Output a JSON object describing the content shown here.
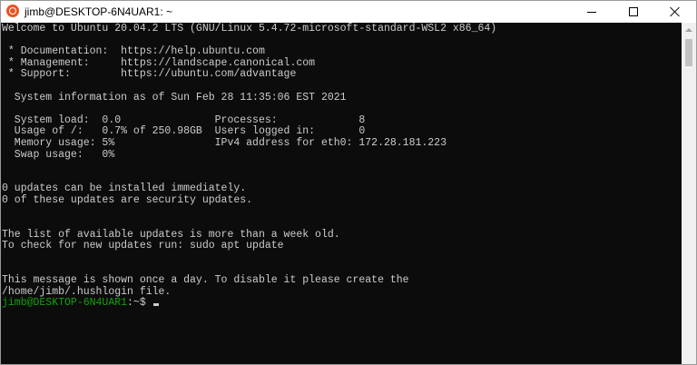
{
  "window": {
    "title": "jimb@DESKTOP-6N4UAR1: ~",
    "app_icon": "ubuntu-icon"
  },
  "terminal": {
    "lines": [
      "Welcome to Ubuntu 20.04.2 LTS (GNU/Linux 5.4.72-microsoft-standard-WSL2 x86_64)",
      "",
      " * Documentation:  https://help.ubuntu.com",
      " * Management:     https://landscape.canonical.com",
      " * Support:        https://ubuntu.com/advantage",
      "",
      "  System information as of Sun Feb 28 11:35:06 EST 2021",
      "",
      "  System load:  0.0               Processes:             8",
      "  Usage of /:   0.7% of 250.98GB  Users logged in:       0",
      "  Memory usage: 5%                IPv4 address for eth0: 172.28.181.223",
      "  Swap usage:   0%",
      "",
      "",
      "0 updates can be installed immediately.",
      "0 of these updates are security updates.",
      "",
      "",
      "The list of available updates is more than a week old.",
      "To check for new updates run: sudo apt update",
      "",
      "",
      "This message is shown once a day. To disable it please create the",
      "/home/jimb/.hushlogin file."
    ],
    "prompt_user": "jimb@DESKTOP-6N4UAR1",
    "prompt_suffix": ":~$ "
  },
  "colors": {
    "terminal_bg": "#0c0c0c",
    "terminal_fg": "#cccccc",
    "prompt_green": "#13a10e",
    "ubuntu_orange": "#e95420"
  }
}
